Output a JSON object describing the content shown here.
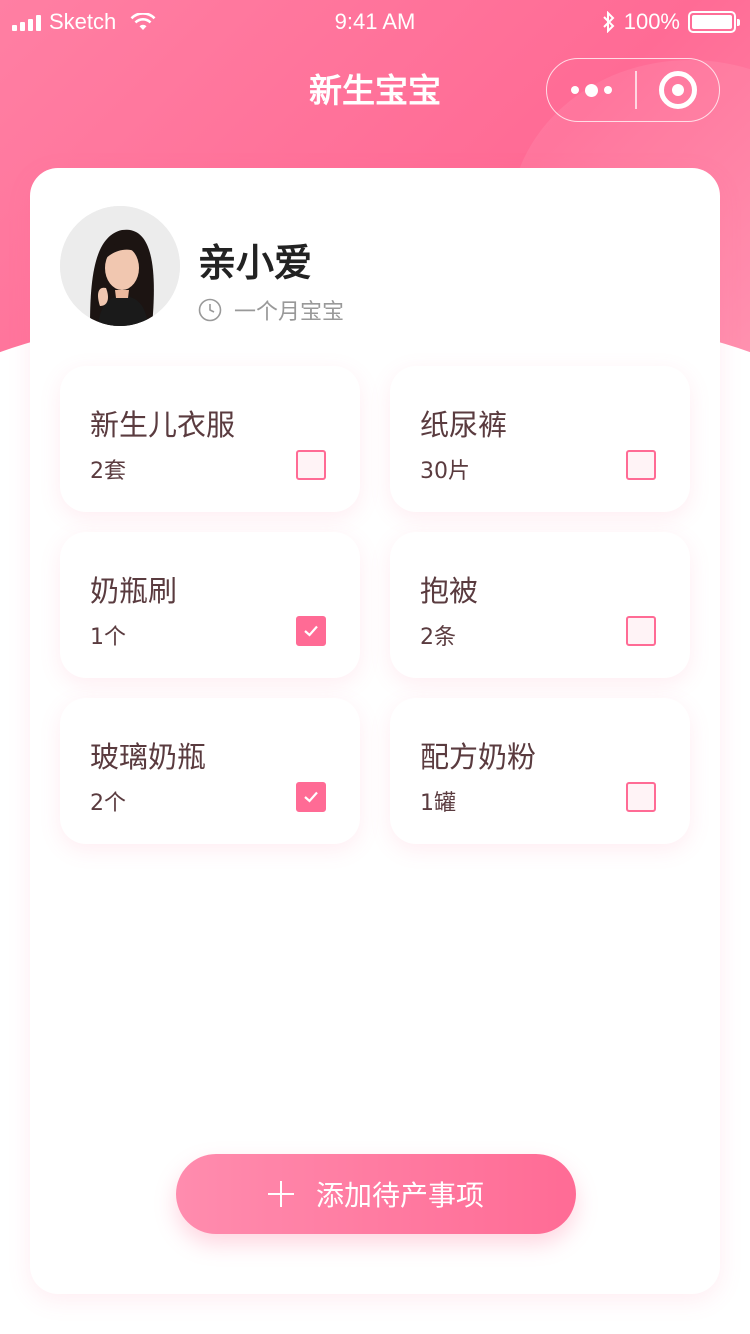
{
  "status_bar": {
    "carrier": "Sketch",
    "time": "9:41 AM",
    "battery": "100%"
  },
  "nav": {
    "title": "新生宝宝",
    "more_icon": "more-dots-icon",
    "close_icon": "target-close-icon"
  },
  "profile": {
    "name": "亲小爱",
    "meta": "一个月宝宝",
    "meta_icon": "clock-icon"
  },
  "items": [
    {
      "name": "新生儿衣服",
      "qty": "2套",
      "checked": false
    },
    {
      "name": "纸尿裤",
      "qty": "30片",
      "checked": false
    },
    {
      "name": "奶瓶刷",
      "qty": "1个",
      "checked": true
    },
    {
      "name": "抱被",
      "qty": "2条",
      "checked": false
    },
    {
      "name": "玻璃奶瓶",
      "qty": "2个",
      "checked": true
    },
    {
      "name": "配方奶粉",
      "qty": "1罐",
      "checked": false
    }
  ],
  "add_button": {
    "label": "添加待产事项",
    "icon": "plus-icon"
  },
  "colors": {
    "accent": "#ff6b95",
    "text": "#5a3b3f"
  }
}
